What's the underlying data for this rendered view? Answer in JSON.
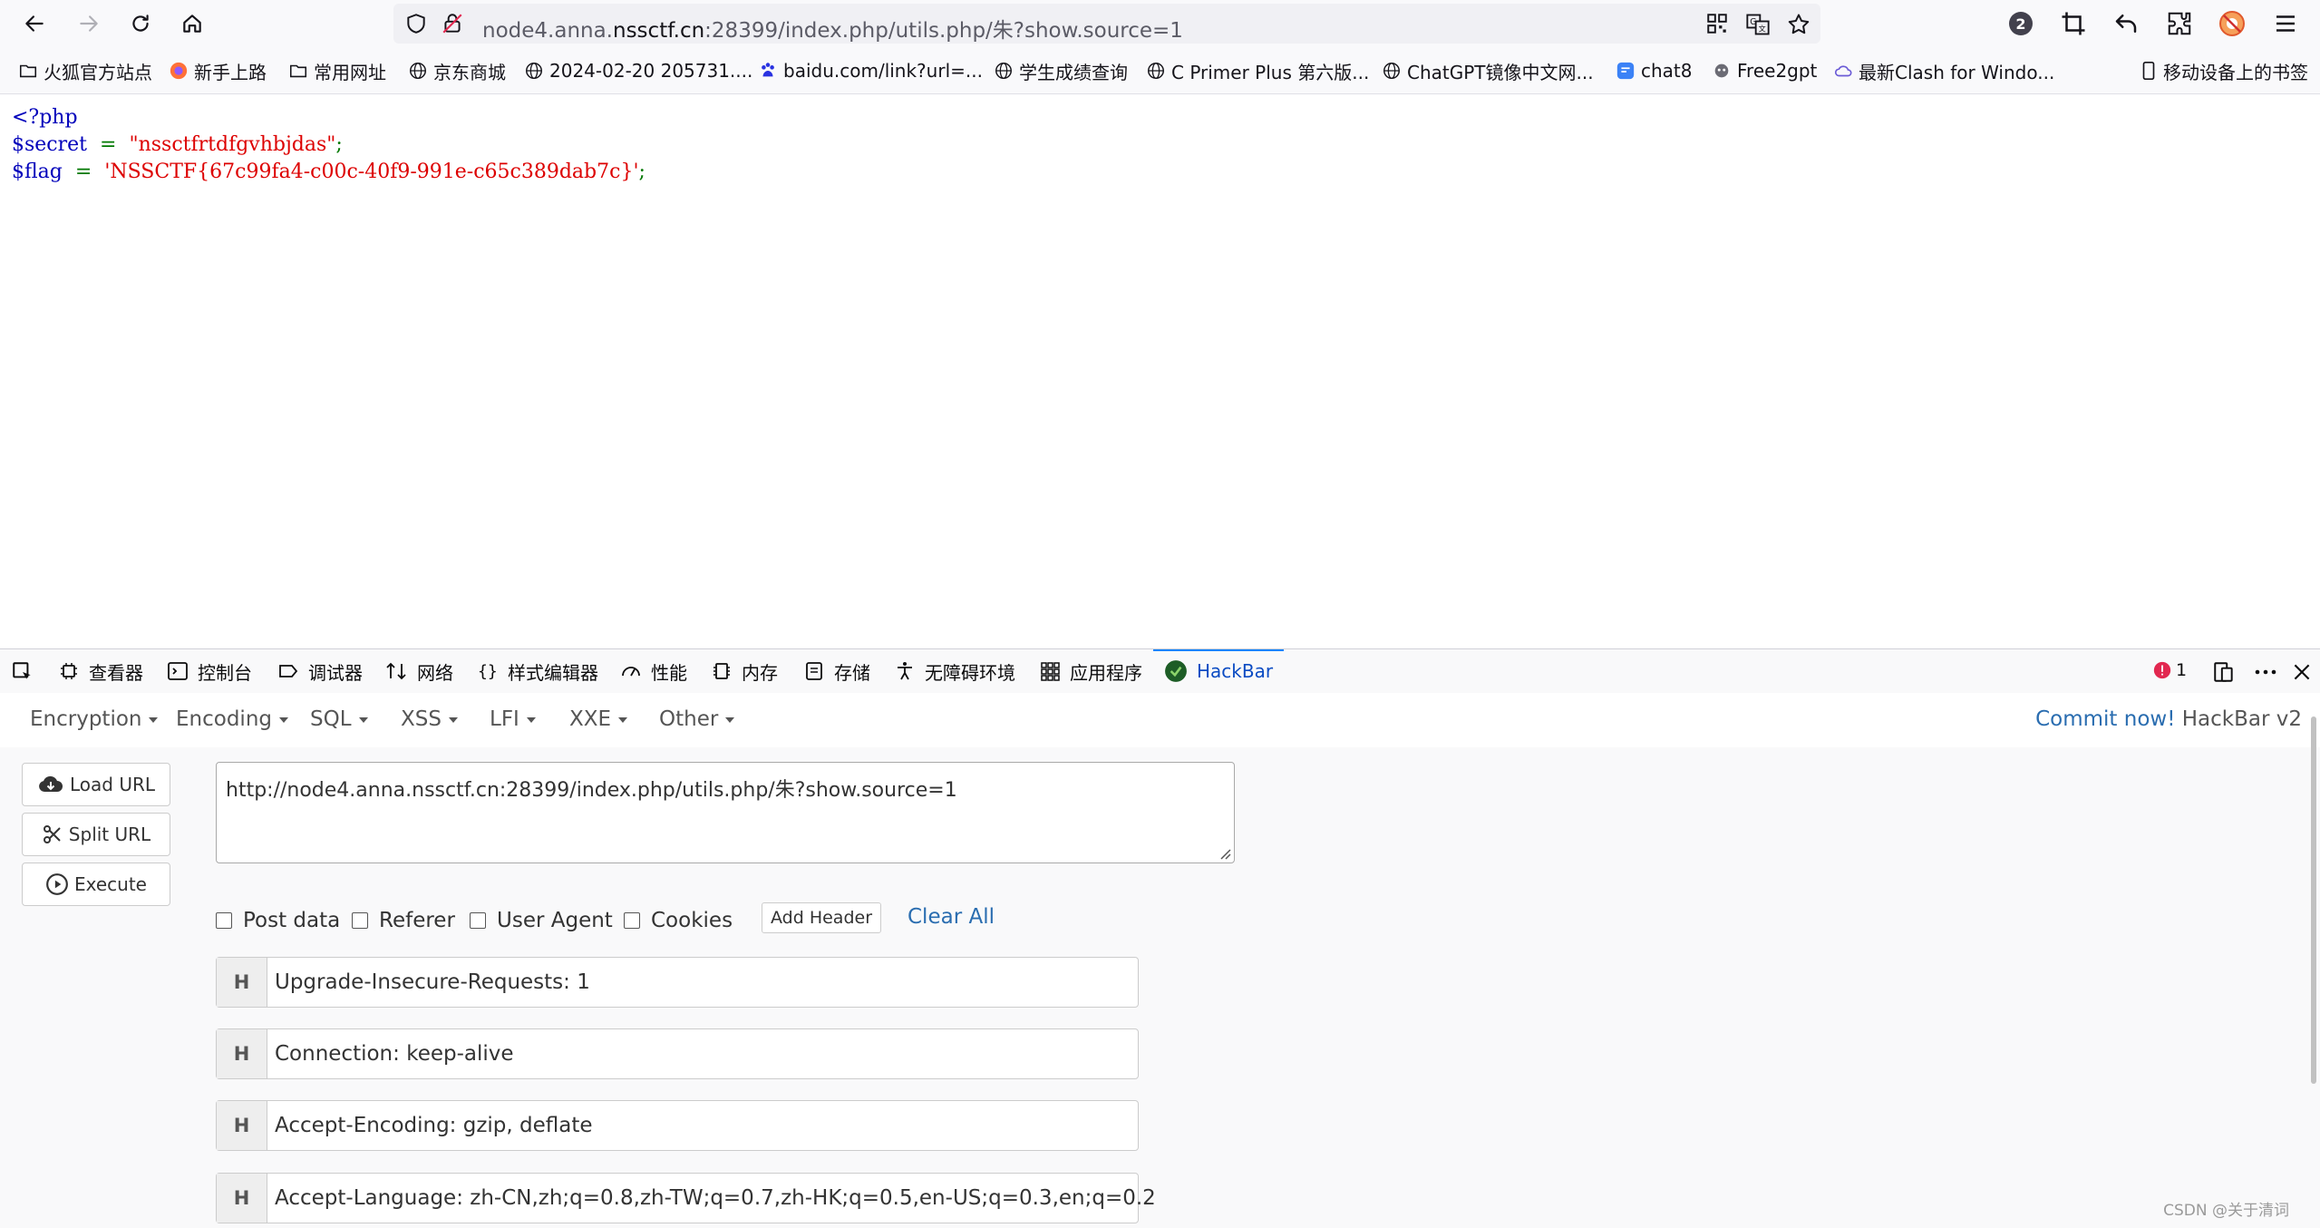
{
  "browser": {
    "url_prefix": "node4.anna.",
    "url_domain": "nssctf.cn",
    "url_suffix": ":28399/index.php/utils.php/朱?show.source=1",
    "notification_count": "2"
  },
  "bookmarks": [
    {
      "label": "火狐官方站点",
      "icon": "folder-icon"
    },
    {
      "label": "新手上路",
      "icon": "firefox-icon"
    },
    {
      "label": "常用网址",
      "icon": "folder-icon"
    },
    {
      "label": "京东商城",
      "icon": "globe-icon"
    },
    {
      "label": "2024-02-20 205731....",
      "icon": "globe-icon"
    },
    {
      "label": "baidu.com/link?url=...",
      "icon": "baidu-icon"
    },
    {
      "label": "学生成绩查询",
      "icon": "globe-icon"
    },
    {
      "label": "C Primer Plus 第六版...",
      "icon": "globe-icon"
    },
    {
      "label": "ChatGPT镜像中文网...",
      "icon": "globe-icon"
    },
    {
      "label": "chat8",
      "icon": "chat-icon"
    },
    {
      "label": "Free2gpt",
      "icon": "free2gpt-icon"
    },
    {
      "label": "最新Clash for Windo...",
      "icon": "cloud-icon"
    },
    {
      "label": "移动设备上的书签",
      "icon": "mobile-icon"
    }
  ],
  "source": {
    "line1": "<?php",
    "line2_var": "$secret",
    "line2_eq": "=",
    "line2_str": "\"nssctfrtdfgvhbjdas\"",
    "line2_end": ";",
    "line3_var": "$flag",
    "line3_eq": "=",
    "line3_str": "'NSSCTF{67c99fa4-c00c-40f9-991e-c65c389dab7c}'",
    "line3_end": ";"
  },
  "devtools": {
    "tabs": [
      {
        "label": "查看器",
        "icon": "inspector-icon"
      },
      {
        "label": "控制台",
        "icon": "console-icon"
      },
      {
        "label": "调试器",
        "icon": "debugger-icon"
      },
      {
        "label": "网络",
        "icon": "network-icon"
      },
      {
        "label": "样式编辑器",
        "icon": "style-editor-icon"
      },
      {
        "label": "性能",
        "icon": "performance-icon"
      },
      {
        "label": "内存",
        "icon": "memory-icon"
      },
      {
        "label": "存储",
        "icon": "storage-icon"
      },
      {
        "label": "无障碍环境",
        "icon": "accessibility-icon"
      },
      {
        "label": "应用程序",
        "icon": "application-icon"
      },
      {
        "label": "HackBar",
        "icon": "hackbar-icon",
        "active": true
      }
    ],
    "error_count": "1"
  },
  "hackbar": {
    "menu": [
      "Encryption",
      "Encoding",
      "SQL",
      "XSS",
      "LFI",
      "XXE",
      "Other"
    ],
    "commit_link": "Commit now!",
    "commit_text": " HackBar v2",
    "buttons": {
      "load_url": "Load URL",
      "split_url": "Split URL",
      "execute": "Execute"
    },
    "url_value": "http://node4.anna.nssctf.cn:28399/index.php/utils.php/朱?show.source=1",
    "options": {
      "post_data": "Post data",
      "referer": "Referer",
      "user_agent": "User Agent",
      "cookies": "Cookies",
      "add_header": "Add Header",
      "clear_all": "Clear All"
    },
    "headers": [
      {
        "badge": "H",
        "value": "Upgrade-Insecure-Requests: 1"
      },
      {
        "badge": "H",
        "value": "Connection: keep-alive"
      },
      {
        "badge": "H",
        "value": "Accept-Encoding: gzip, deflate"
      },
      {
        "badge": "H",
        "value": "Accept-Language: zh-CN,zh;q=0.8,zh-TW;q=0.7,zh-HK;q=0.5,en-US;q=0.3,en;q=0.2"
      }
    ]
  },
  "watermark": "CSDN @关于清词",
  "colors": {
    "php_keyword": "#0000bb",
    "php_string": "#dd0000",
    "php_operator": "#007700",
    "link": "#2a6db0"
  }
}
